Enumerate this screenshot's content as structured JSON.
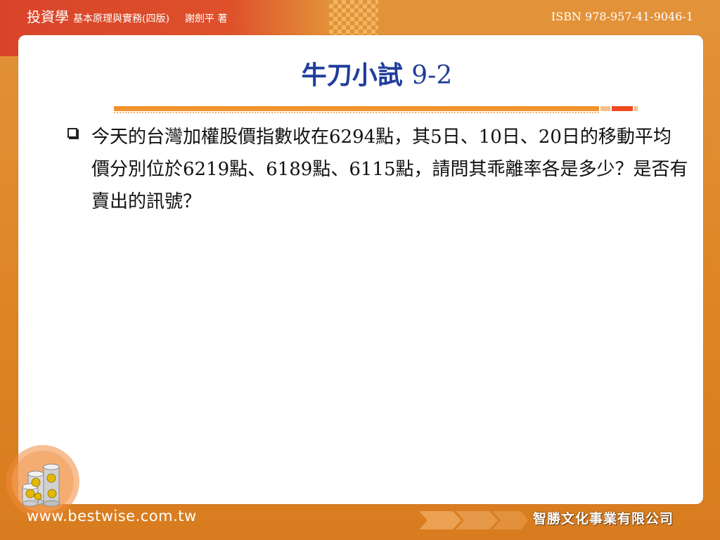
{
  "header": {
    "brand": "投資學",
    "subtitle": "基本原理與實務(四版)",
    "author": "謝劍平 著",
    "isbn": "ISBN 978-957-41-9046-1"
  },
  "slide": {
    "title_main": "牛刀小試",
    "title_number": "9-2",
    "bullet_text": "今天的台灣加權股價指數收在6294點，其5日、10日、20日的移動平均價分別位於6219點、6189點、6115點，請問其乖離率各是多少？是否有賣出的訊號？"
  },
  "footer": {
    "url": "www.bestwise.com.tw",
    "company": "智勝文化事業有限公司"
  },
  "colors": {
    "background": "#e08a2a",
    "header_band": "#d9432a",
    "title": "#1f3d9a",
    "rule": "#f2922c",
    "rule_accent": "#ef4a1e"
  }
}
